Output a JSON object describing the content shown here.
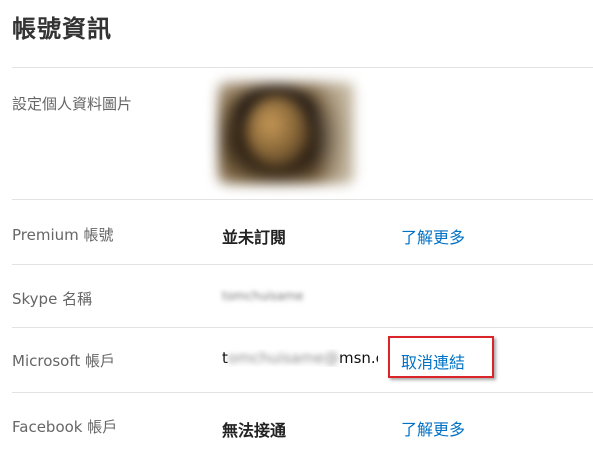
{
  "page_title": "帳號資訊",
  "rows": [
    {
      "label": "設定個人資料圖片"
    },
    {
      "label": "Premium 帳號",
      "value": "並未訂閱",
      "link": "了解更多"
    },
    {
      "label": "Skype 名稱",
      "value": "tomchuisame"
    },
    {
      "label": "Microsoft 帳戶",
      "value_prefix": "t",
      "value_blurred": "omchuisame@",
      "value_suffix": "msn.co",
      "link": "取消連結"
    },
    {
      "label": "Facebook 帳戶",
      "value": "無法接通",
      "link": "了解更多"
    }
  ],
  "colors": {
    "link": "#0072c6",
    "highlight": "#d9252a",
    "divider": "#e3e3e3"
  }
}
